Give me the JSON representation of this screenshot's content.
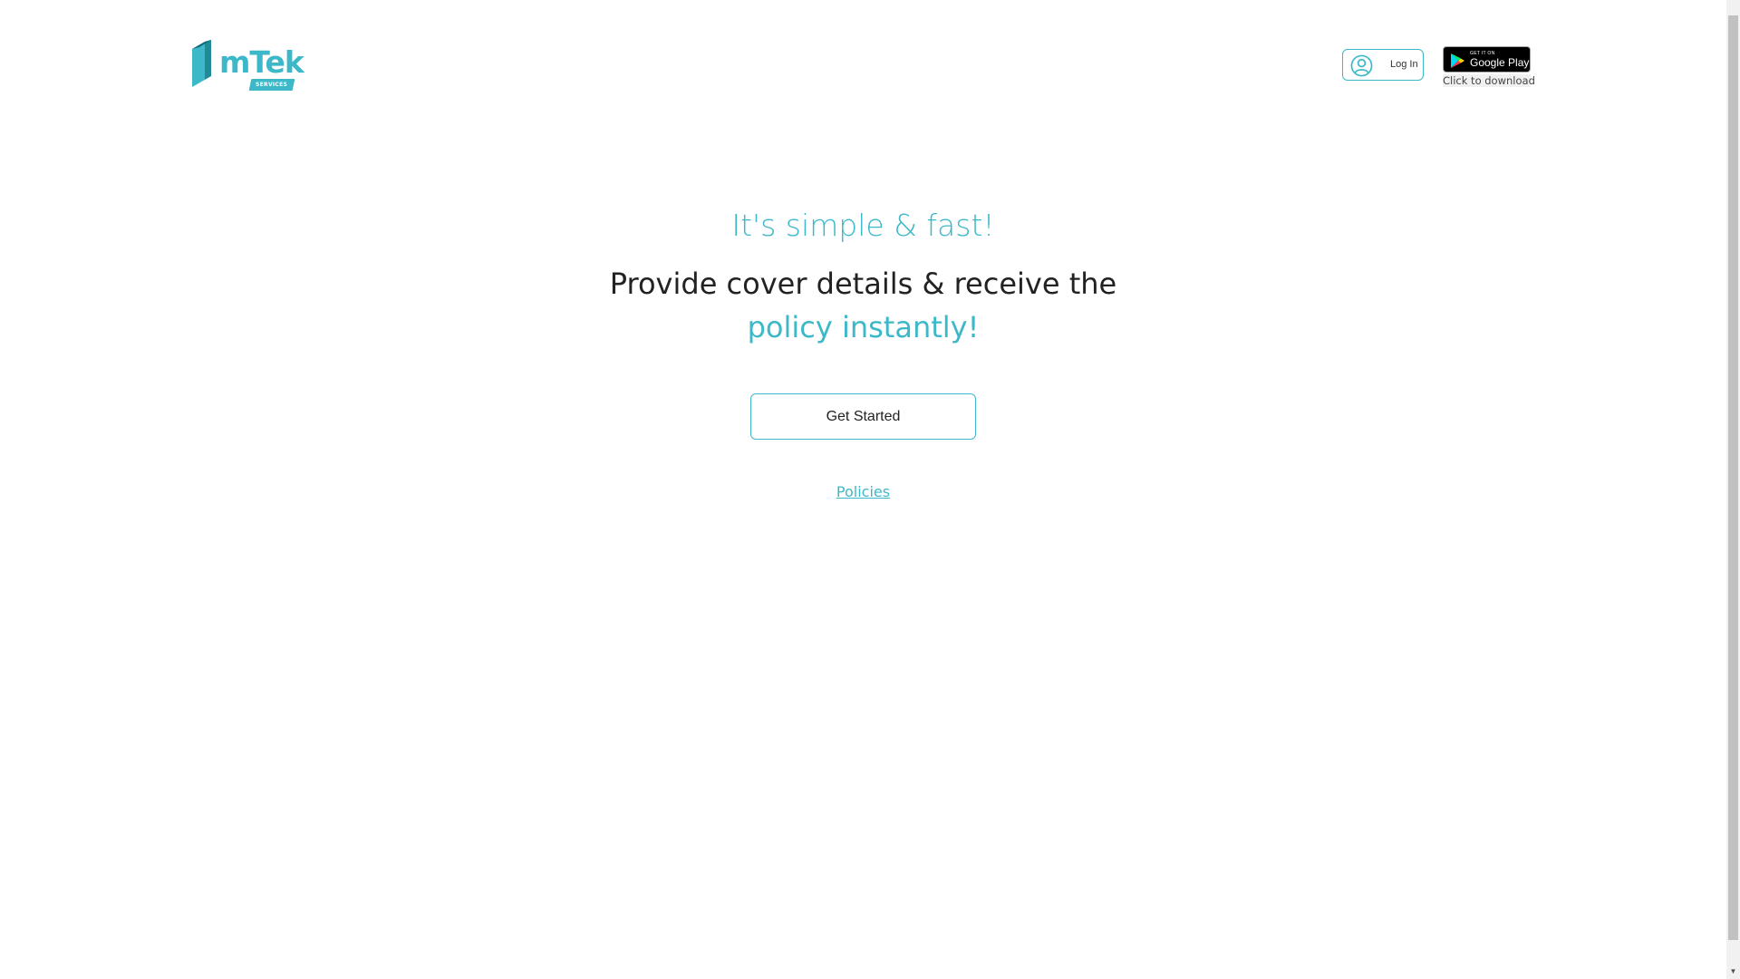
{
  "header": {
    "logo": {
      "brand": "mTek",
      "badge": "SERVICES",
      "icon": "cube-logo-icon"
    },
    "login": {
      "label": "Log In",
      "icon": "user-circle-icon"
    },
    "google_play": {
      "small_text": "GET IT ON",
      "store_name": "Google Play",
      "caption": "Click to download",
      "icon": "play-triangle-icon"
    }
  },
  "hero": {
    "title": "It's simple & fast!",
    "subtitle_plain": "Provide cover details & receive the ",
    "subtitle_accent": "policy instantly!",
    "cta_label": "Get Started",
    "policies_link": "Policies"
  },
  "colors": {
    "accent": "#3db8c8",
    "text": "#222222",
    "background": "#ffffff"
  },
  "scrollbar": {
    "down_arrow": "chevron-down-icon"
  }
}
